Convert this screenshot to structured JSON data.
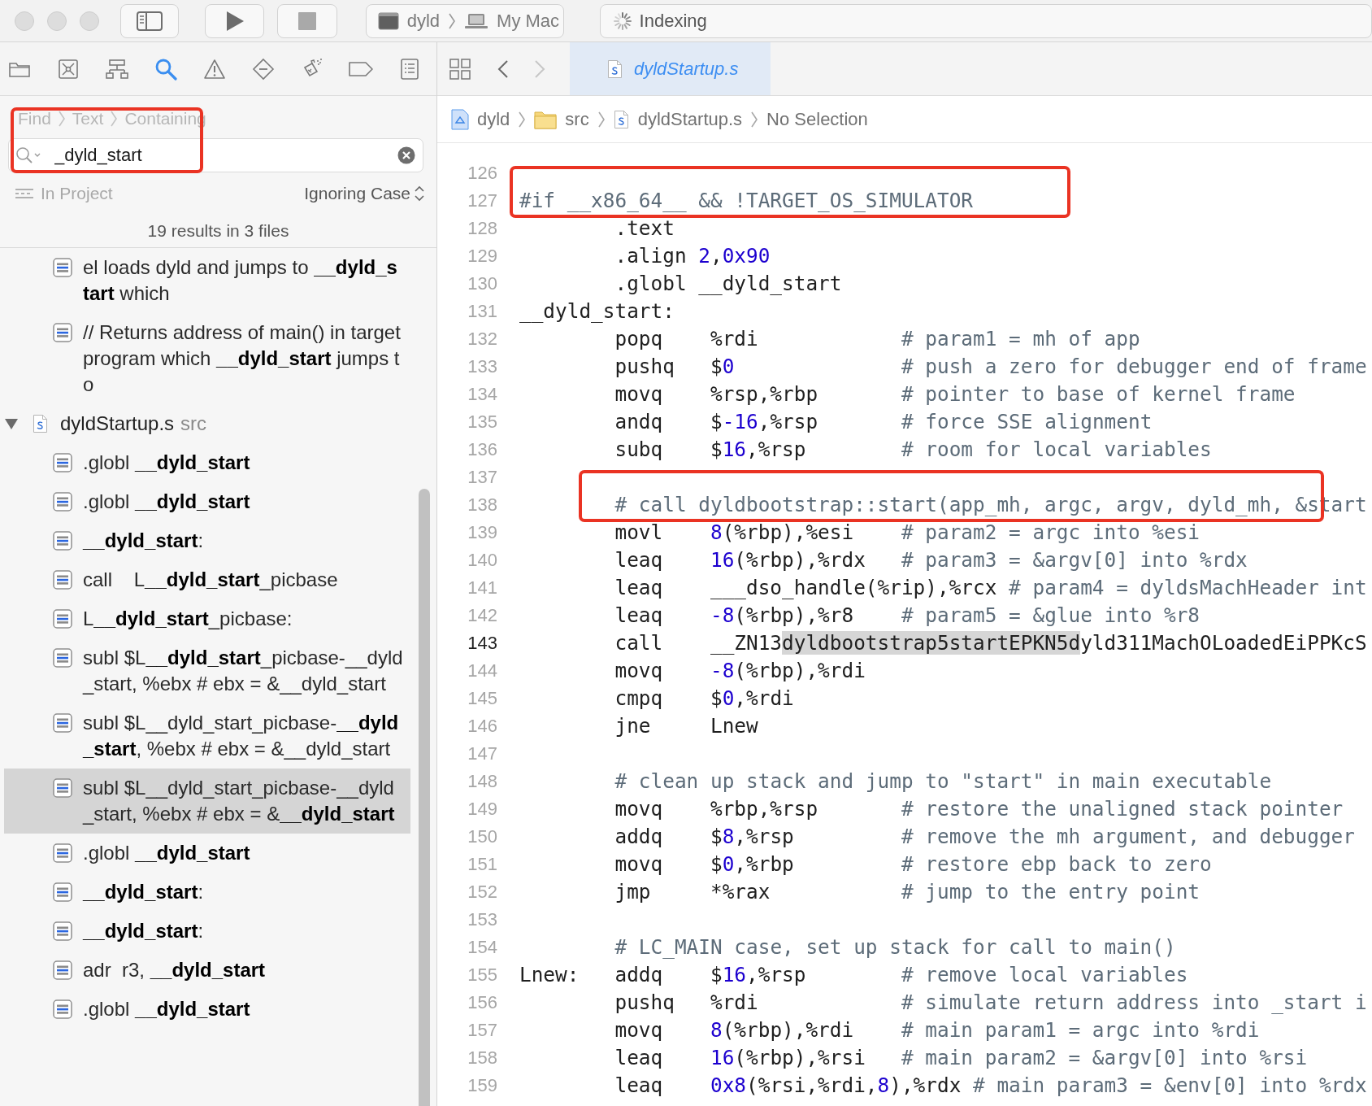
{
  "toolbar": {
    "buttons": [
      {
        "kind": "run",
        "disabled": false
      },
      {
        "kind": "stop",
        "disabled": true
      }
    ],
    "scheme": {
      "target": "dyld",
      "device": "My Mac"
    },
    "activity": "Indexing"
  },
  "navigator": {
    "tabs": [
      {
        "kind": "folder",
        "selected": false
      },
      {
        "kind": "crossed-box",
        "selected": false
      },
      {
        "kind": "hierarchy",
        "selected": false
      },
      {
        "kind": "search",
        "selected": true
      },
      {
        "kind": "warning",
        "selected": false
      },
      {
        "kind": "diamond",
        "selected": false
      },
      {
        "kind": "spray-can",
        "selected": false
      },
      {
        "kind": "tag",
        "selected": false
      },
      {
        "kind": "list",
        "selected": false
      }
    ],
    "find": {
      "breadcrumb": [
        "Find",
        "Text",
        "Containing"
      ],
      "query": "_dyld_start",
      "boxed": true,
      "scope": "In Project",
      "matching": "Ignoring Case",
      "summary": "19 results in 3 files"
    },
    "results": [
      {
        "kind": "match",
        "text": "el loads dyld and jumps to **__dyld_start** which",
        "selected": false
      },
      {
        "kind": "match",
        "text": "// Returns address of main() in target program which **__dyld_start** jumps to",
        "selected": false
      },
      {
        "kind": "file",
        "name": "dyldStartup.s",
        "folder": "src",
        "expanded": true,
        "children": [
          {
            "kind": "match",
            "text": ".globl **__dyld_start**",
            "selected": false
          },
          {
            "kind": "match",
            "text": ".globl **__dyld_start**",
            "selected": false
          },
          {
            "kind": "match",
            "text": "**__dyld_start**:",
            "selected": false
          },
          {
            "kind": "match",
            "text": "call    L**__dyld_start**_picbase",
            "selected": false
          },
          {
            "kind": "match",
            "text": "L**__dyld_start**_picbase:",
            "selected": false
          },
          {
            "kind": "match",
            "text": "subl $L**__dyld_start**_picbase-__dyld_start, %ebx # ebx = &__dyld_start",
            "selected": false
          },
          {
            "kind": "match",
            "text": "subl $L__dyld_start_picbase-**__dyld_start**, %ebx # ebx = &__dyld_start",
            "selected": false
          },
          {
            "kind": "match",
            "text": "subl $L__dyld_start_picbase-__dyld_start, %ebx # ebx = &**__dyld_start**",
            "selected": true
          },
          {
            "kind": "match",
            "text": ".globl **__dyld_start**",
            "selected": false
          },
          {
            "kind": "match",
            "text": "**__dyld_start**:",
            "selected": false
          },
          {
            "kind": "match",
            "text": "**__dyld_start**:",
            "selected": false
          },
          {
            "kind": "match",
            "text": "adr  r3, **__dyld_start**",
            "selected": false
          },
          {
            "kind": "match",
            "text": ".globl **__dyld_start**",
            "selected": false
          }
        ]
      }
    ]
  },
  "editor": {
    "back": {
      "disabled": false
    },
    "forward": {
      "disabled": true
    },
    "tabs": [
      {
        "title": "dyldStartup.s",
        "selected": true
      }
    ],
    "jump_bar": [
      {
        "kind": "project",
        "label": "dyld"
      },
      {
        "kind": "folder",
        "label": "src"
      },
      {
        "kind": "file",
        "label": "dyldStartup.s"
      },
      {
        "kind": "none",
        "label": "No Selection"
      }
    ],
    "lines": [
      {
        "number": "126",
        "current": false
      },
      {
        "number": "127",
        "current": false,
        "boxed": true,
        "tokens": [
          {
            "kind": "preprocessor",
            "text": "#if __x86_64__ && !TARGET_OS_SIMULATOR"
          }
        ]
      },
      {
        "number": "128",
        "current": false,
        "tokens": [
          {
            "kind": "plain",
            "text": "        .text"
          }
        ]
      },
      {
        "number": "129",
        "current": false,
        "tokens": [
          {
            "kind": "plain",
            "text": "        .align "
          },
          {
            "kind": "number",
            "text": "2"
          },
          {
            "kind": "plain",
            "text": ","
          },
          {
            "kind": "number",
            "text": "0x90"
          }
        ]
      },
      {
        "number": "130",
        "current": false,
        "tokens": [
          {
            "kind": "plain",
            "text": "        .globl __dyld_start"
          }
        ]
      },
      {
        "number": "131",
        "current": false,
        "tokens": [
          {
            "kind": "plain",
            "text": "__dyld_start:"
          }
        ]
      },
      {
        "number": "132",
        "current": false,
        "tokens": [
          {
            "kind": "plain",
            "text": "        popq    %rdi"
          },
          {
            "kind": "comment",
            "text": "# param1 = mh of app"
          }
        ]
      },
      {
        "number": "133",
        "current": false,
        "tokens": [
          {
            "kind": "plain",
            "text": "        pushq   $"
          },
          {
            "kind": "number",
            "text": "0"
          },
          {
            "kind": "comment",
            "text": "# push a zero for debugger end of frame"
          }
        ]
      },
      {
        "number": "134",
        "current": false,
        "tokens": [
          {
            "kind": "plain",
            "text": "        movq    %rsp,%rbp"
          },
          {
            "kind": "comment",
            "text": "# pointer to base of kernel frame"
          }
        ]
      },
      {
        "number": "135",
        "current": false,
        "tokens": [
          {
            "kind": "plain",
            "text": "        andq    $"
          },
          {
            "kind": "number",
            "text": "-16"
          },
          {
            "kind": "plain",
            "text": ",%rsp"
          },
          {
            "kind": "comment",
            "text": "# force SSE alignment"
          }
        ]
      },
      {
        "number": "136",
        "current": false,
        "tokens": [
          {
            "kind": "plain",
            "text": "        subq    $"
          },
          {
            "kind": "number",
            "text": "16"
          },
          {
            "kind": "plain",
            "text": ",%rsp"
          },
          {
            "kind": "comment",
            "text": "# room for local variables"
          }
        ]
      },
      {
        "number": "137",
        "current": false
      },
      {
        "number": "138",
        "current": false,
        "boxed": true,
        "tokens": [
          {
            "kind": "comment",
            "text": "# call dyldbootstrap::start(app_mh, argc, argv, dyld_mh, &start"
          }
        ]
      },
      {
        "number": "139",
        "current": false,
        "tokens": [
          {
            "kind": "plain",
            "text": "        movl    "
          },
          {
            "kind": "number",
            "text": "8"
          },
          {
            "kind": "plain",
            "text": "(%rbp),%esi"
          },
          {
            "kind": "comment",
            "text": "# param2 = argc into %esi"
          }
        ]
      },
      {
        "number": "140",
        "current": false,
        "tokens": [
          {
            "kind": "plain",
            "text": "        leaq    "
          },
          {
            "kind": "number",
            "text": "16"
          },
          {
            "kind": "plain",
            "text": "(%rbp),%rdx"
          },
          {
            "kind": "comment",
            "text": "# param3 = &argv[0] into %rdx"
          }
        ]
      },
      {
        "number": "141",
        "current": false,
        "tokens": [
          {
            "kind": "plain",
            "text": "        leaq    ___dso_handle(%rip),%rcx"
          },
          {
            "kind": "comment",
            "text": "# param4 = dyldsMachHeader int"
          }
        ]
      },
      {
        "number": "142",
        "current": false,
        "tokens": [
          {
            "kind": "plain",
            "text": "        leaq    "
          },
          {
            "kind": "number",
            "text": "-8"
          },
          {
            "kind": "plain",
            "text": "(%rbp),%r8"
          },
          {
            "kind": "comment",
            "text": "# param5 = &glue into %r8"
          }
        ]
      },
      {
        "number": "143",
        "current": true,
        "tokens": [
          {
            "kind": "plain",
            "text": "        call    __ZN13"
          },
          {
            "kind": "highlight",
            "text": "dyldbootstrap5startEPKN5d"
          },
          {
            "kind": "plain",
            "text": "yld311MachOLoadedEiPPKcS"
          }
        ]
      },
      {
        "number": "144",
        "current": false,
        "tokens": [
          {
            "kind": "plain",
            "text": "        movq    "
          },
          {
            "kind": "number",
            "text": "-8"
          },
          {
            "kind": "plain",
            "text": "(%rbp),%rdi"
          }
        ]
      },
      {
        "number": "145",
        "current": false,
        "tokens": [
          {
            "kind": "plain",
            "text": "        cmpq    $"
          },
          {
            "kind": "number",
            "text": "0"
          },
          {
            "kind": "plain",
            "text": ",%rdi"
          }
        ]
      },
      {
        "number": "146",
        "current": false,
        "tokens": [
          {
            "kind": "plain",
            "text": "        jne     Lnew"
          }
        ]
      },
      {
        "number": "147",
        "current": false
      },
      {
        "number": "148",
        "current": false,
        "tokens": [
          {
            "kind": "comment",
            "text": "# clean up stack and jump to \"start\" in main executable"
          }
        ]
      },
      {
        "number": "149",
        "current": false,
        "tokens": [
          {
            "kind": "plain",
            "text": "        movq    %rbp,%rsp"
          },
          {
            "kind": "comment",
            "text": "# restore the unaligned stack pointer"
          }
        ]
      },
      {
        "number": "150",
        "current": false,
        "tokens": [
          {
            "kind": "plain",
            "text": "        addq    $"
          },
          {
            "kind": "number",
            "text": "8"
          },
          {
            "kind": "plain",
            "text": ",%rsp"
          },
          {
            "kind": "comment",
            "text": "# remove the mh argument, and debugger"
          }
        ]
      },
      {
        "number": "151",
        "current": false,
        "tokens": [
          {
            "kind": "plain",
            "text": "        movq    $"
          },
          {
            "kind": "number",
            "text": "0"
          },
          {
            "kind": "plain",
            "text": ",%rbp"
          },
          {
            "kind": "comment",
            "text": "# restore ebp back to zero"
          }
        ]
      },
      {
        "number": "152",
        "current": false,
        "tokens": [
          {
            "kind": "plain",
            "text": "        jmp     *%rax"
          },
          {
            "kind": "comment",
            "text": "# jump to the entry point"
          }
        ]
      },
      {
        "number": "153",
        "current": false
      },
      {
        "number": "154",
        "current": false,
        "tokens": [
          {
            "kind": "comment",
            "text": "# LC_MAIN case, set up stack for call to main()"
          }
        ]
      },
      {
        "number": "155",
        "current": false,
        "tokens": [
          {
            "kind": "plain",
            "text": "Lnew:   addq    $"
          },
          {
            "kind": "number",
            "text": "16"
          },
          {
            "kind": "plain",
            "text": ",%rsp"
          },
          {
            "kind": "comment",
            "text": "# remove local variables"
          }
        ]
      },
      {
        "number": "156",
        "current": false,
        "tokens": [
          {
            "kind": "plain",
            "text": "        pushq   %rdi"
          },
          {
            "kind": "comment",
            "text": "# simulate return address into _start i"
          }
        ]
      },
      {
        "number": "157",
        "current": false,
        "tokens": [
          {
            "kind": "plain",
            "text": "        movq    "
          },
          {
            "kind": "number",
            "text": "8"
          },
          {
            "kind": "plain",
            "text": "(%rbp),%rdi"
          },
          {
            "kind": "comment",
            "text": "# main param1 = argc into %rdi"
          }
        ]
      },
      {
        "number": "158",
        "current": false,
        "tokens": [
          {
            "kind": "plain",
            "text": "        leaq    "
          },
          {
            "kind": "number",
            "text": "16"
          },
          {
            "kind": "plain",
            "text": "(%rbp),%rsi"
          },
          {
            "kind": "comment",
            "text": "# main param2 = &argv[0] into %rsi"
          }
        ]
      },
      {
        "number": "159",
        "current": false,
        "tokens": [
          {
            "kind": "plain",
            "text": "        leaq    "
          },
          {
            "kind": "number",
            "text": "0x8"
          },
          {
            "kind": "plain",
            "text": "(%rsi,%rdi,"
          },
          {
            "kind": "number",
            "text": "8"
          },
          {
            "kind": "plain",
            "text": "),%rdx"
          },
          {
            "kind": "comment",
            "text": "# main param3 = &env[0] into %rdx"
          }
        ]
      }
    ]
  }
}
